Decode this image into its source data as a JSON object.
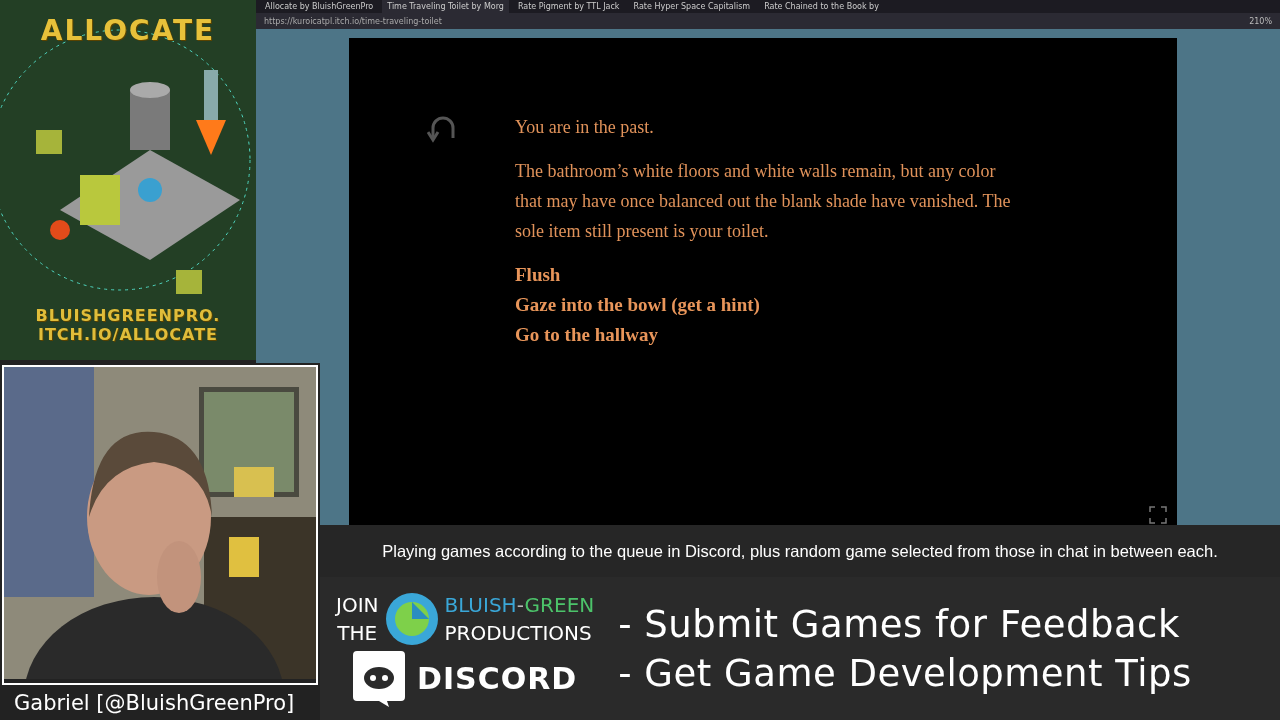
{
  "poster": {
    "title": "ALLOCATE",
    "url_lines": [
      "BLUISHGREENPRO.",
      "ITCH.IO/ALLOCATE"
    ]
  },
  "browser": {
    "tabs": [
      {
        "title": "Allocate by BluishGreenPro",
        "selected": false
      },
      {
        "title": "Time Traveling Toilet by Morg",
        "selected": true
      },
      {
        "title": "Rate Pigment by TTL Jack",
        "selected": false
      },
      {
        "title": "Rate Hyper Space Capitalism",
        "selected": false
      },
      {
        "title": "Rate Chained to the Book by",
        "selected": false
      }
    ],
    "url": "https://kuroicatpl.itch.io/time-traveling-toilet",
    "zoom": "210%"
  },
  "game": {
    "paragraphs": [
      "You are in the past.",
      "The bathroom’s white floors and white walls remain, but any color that may have once balanced out the blank shade have vanished. The sole item still present is your toilet."
    ],
    "choices": [
      "Flush",
      "Gaze into the bowl (get a hint)",
      "Go to the hallway"
    ]
  },
  "webcam": {
    "name": "Gabriel [@BluishGreenPro]"
  },
  "overlay": {
    "caption": "Playing games according to the queue in Discord, plus random game selected from those in chat in between each.",
    "join": [
      "JOIN",
      "THE"
    ],
    "brand": {
      "part1": "BLUISH",
      "dash": "-",
      "part2": "GREEN",
      "line2": "PRODUCTIONS"
    },
    "discord": "DISCORD",
    "bullets": [
      "- Submit Games for Feedback",
      "- Get Game Development Tips"
    ]
  }
}
